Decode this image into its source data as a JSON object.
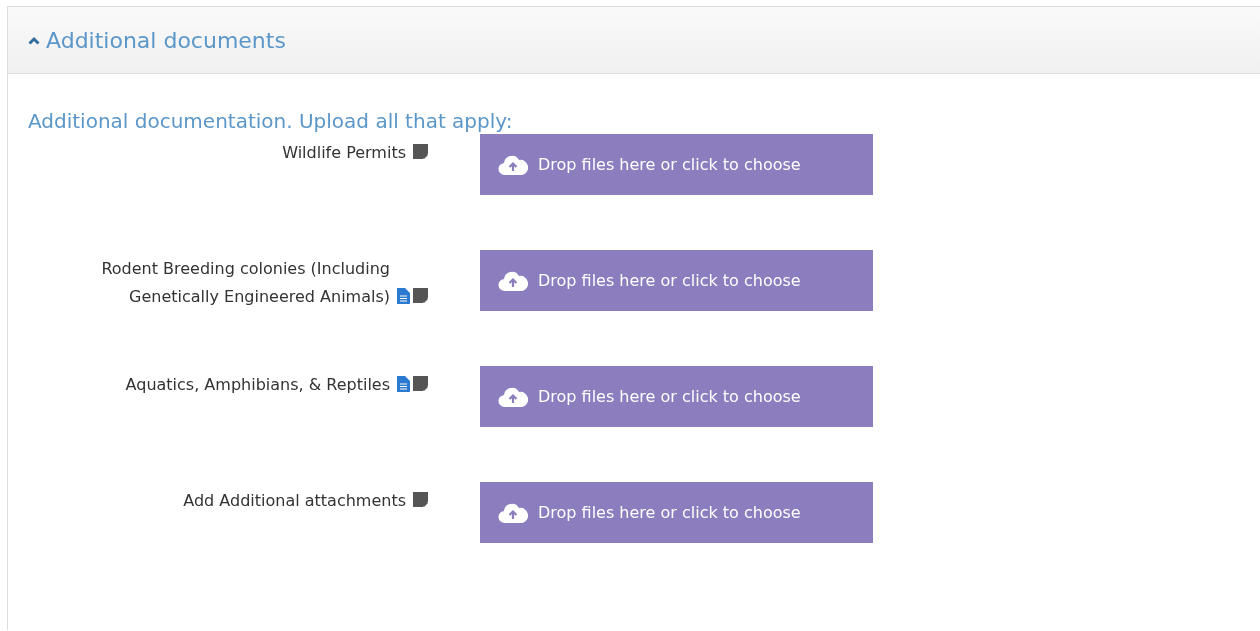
{
  "panel": {
    "title": "Additional documents",
    "expanded": true
  },
  "heading": "Additional documentation. Upload all that apply:",
  "uploads": [
    {
      "label": "Wildlife Permits",
      "icons": [
        {
          "kind": "note"
        }
      ],
      "button": "Drop files here or click to choose"
    },
    {
      "label": "Rodent Breeding colonies (Including Genetically Engineered Animals)",
      "icons": [
        {
          "kind": "document"
        },
        {
          "kind": "note"
        }
      ],
      "button": "Drop files here or click to choose"
    },
    {
      "label": "Aquatics, Amphibians, & Reptiles",
      "icons": [
        {
          "kind": "document"
        },
        {
          "kind": "note"
        }
      ],
      "button": "Drop files here or click to choose"
    },
    {
      "label": "Add Additional attachments",
      "icons": [
        {
          "kind": "note"
        }
      ],
      "button": "Drop files here or click to choose"
    }
  ]
}
